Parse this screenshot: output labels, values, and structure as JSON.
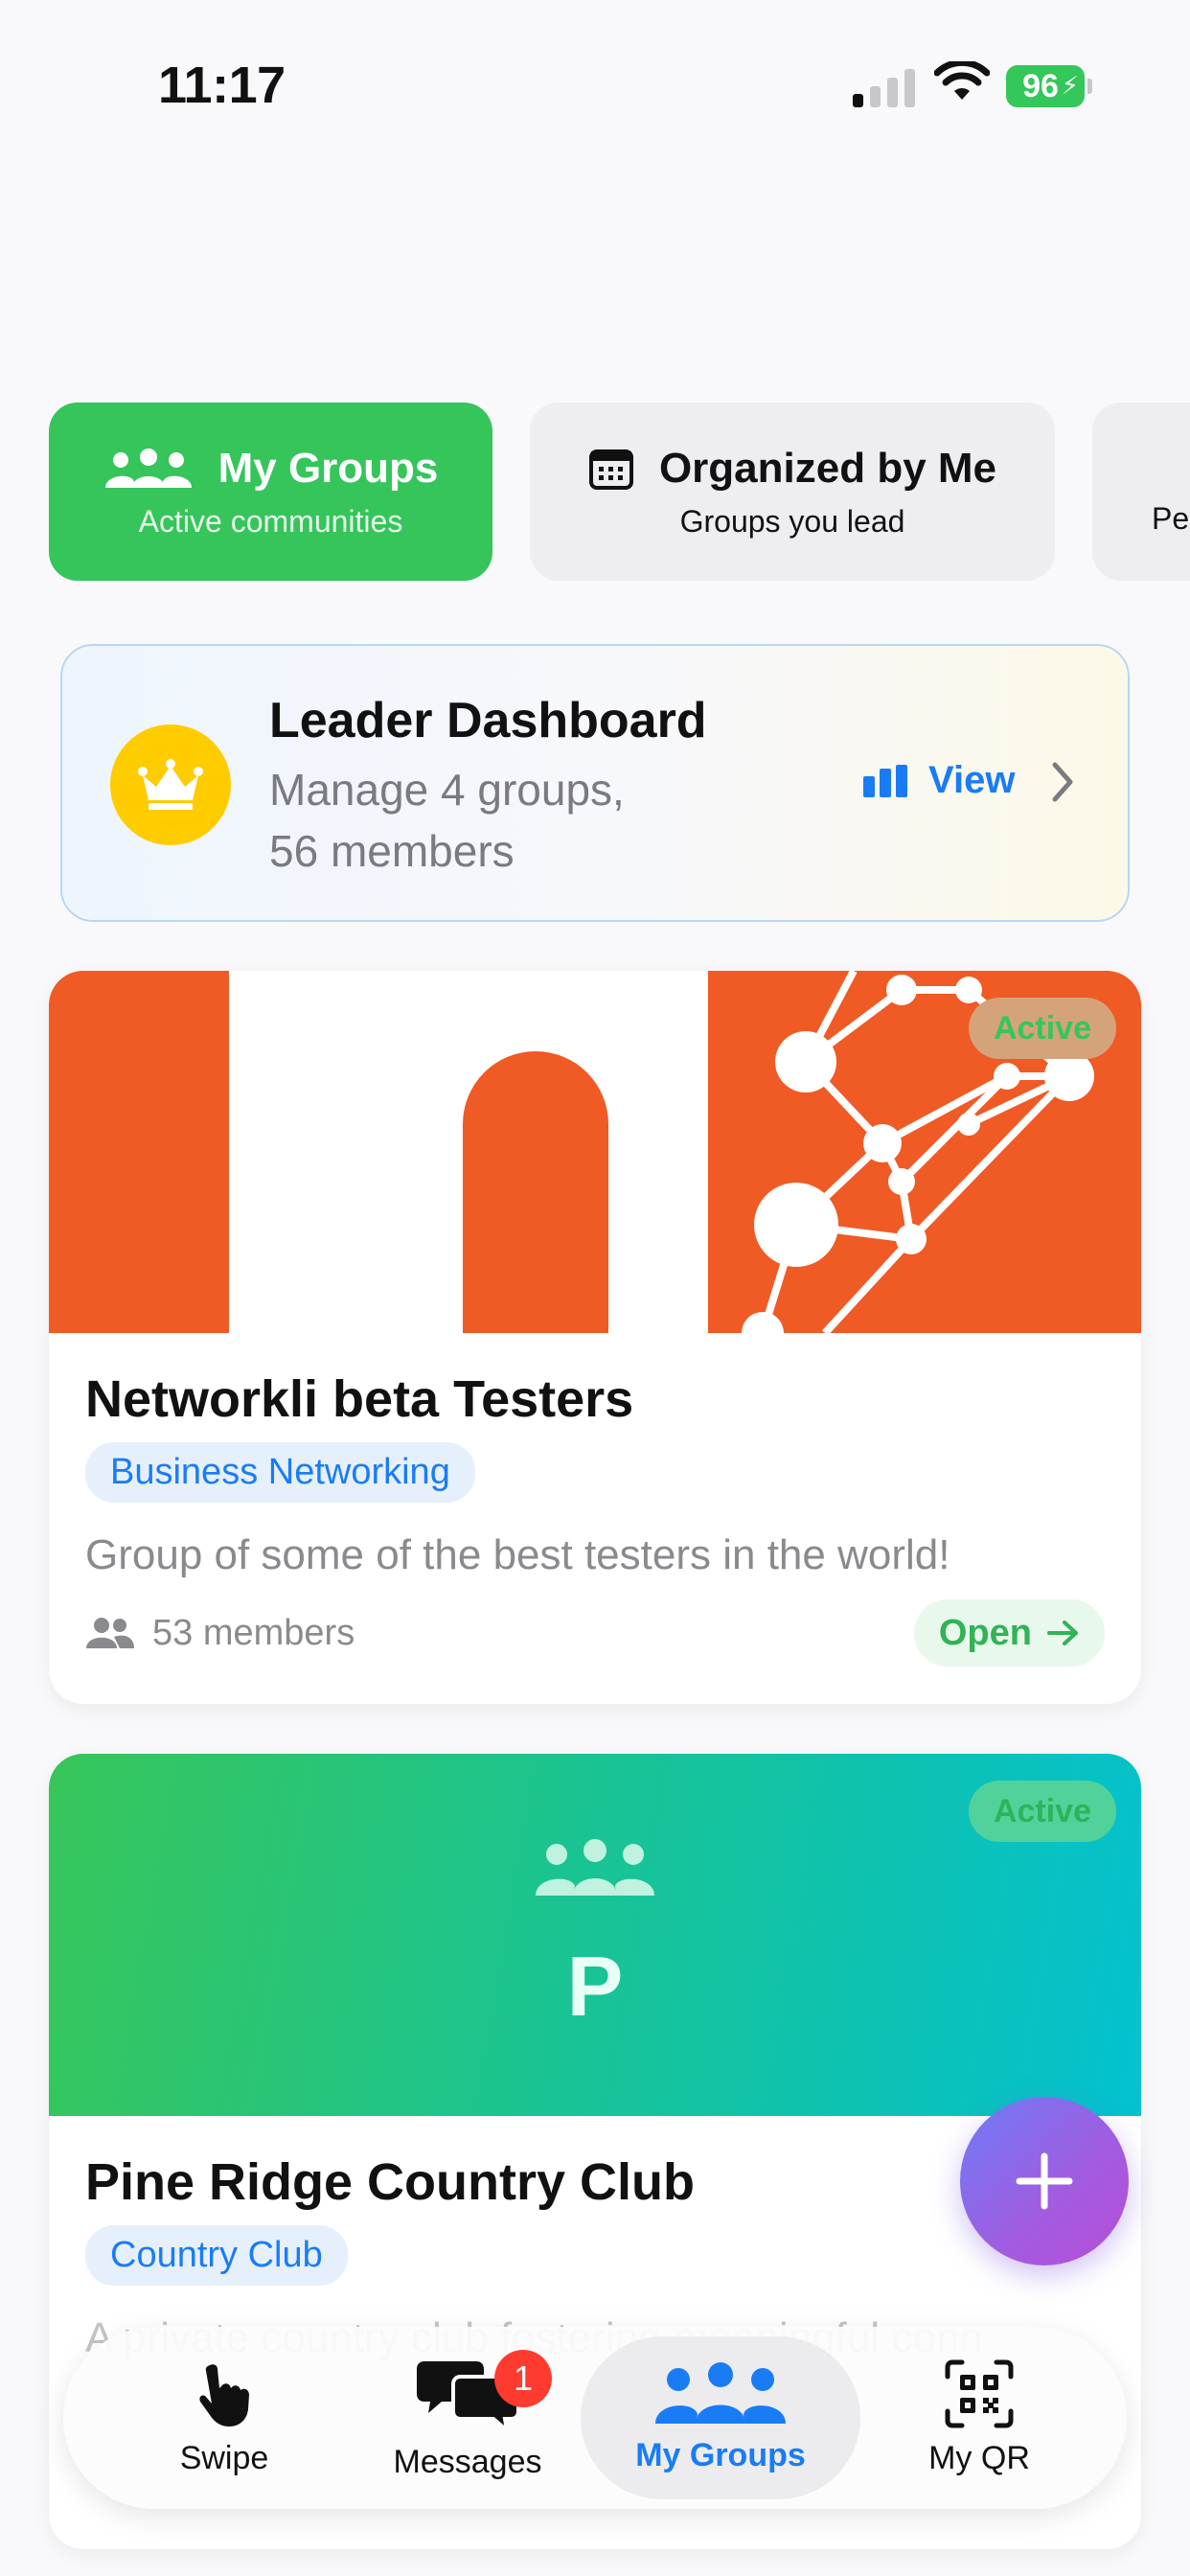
{
  "status_bar": {
    "time": "11:17",
    "battery": "96"
  },
  "filter_tabs": [
    {
      "label": "My Groups",
      "sub": "Active communities",
      "icon": "people-icon",
      "active": true
    },
    {
      "label": "Organized by Me",
      "sub": "Groups you lead",
      "icon": "calendar-icon",
      "active": false
    },
    {
      "label": "",
      "sub": "Pe",
      "icon": "",
      "active": false
    }
  ],
  "leader": {
    "title": "Leader Dashboard",
    "sub": "Manage 4 groups, 56 members",
    "view_label": "View"
  },
  "groups": [
    {
      "name": "Networkli beta Testers",
      "category": "Business Networking",
      "description": "Group of some of the best testers in the world!",
      "members": "53 members",
      "status": "Active",
      "open_label": "Open"
    },
    {
      "name": "Pine Ridge Country Club",
      "category": "Country Club",
      "banner_letter": "P",
      "status": "Active",
      "description_partial": "A private country club fostering meaningful conn"
    }
  ],
  "tab_bar": [
    {
      "label": "Swipe",
      "icon": "hand-tap-icon"
    },
    {
      "label": "Messages",
      "icon": "chat-bubbles-icon",
      "badge": "1"
    },
    {
      "label": "My Groups",
      "icon": "people-icon",
      "active": true
    },
    {
      "label": "My QR",
      "icon": "qr-code-icon"
    }
  ],
  "colors": {
    "accent_green": "#35c55b",
    "accent_blue": "#1a7cf5",
    "brand_orange": "#f05a24",
    "fab_gradient_start": "#6d7cf6",
    "fab_gradient_end": "#b64fd8"
  }
}
